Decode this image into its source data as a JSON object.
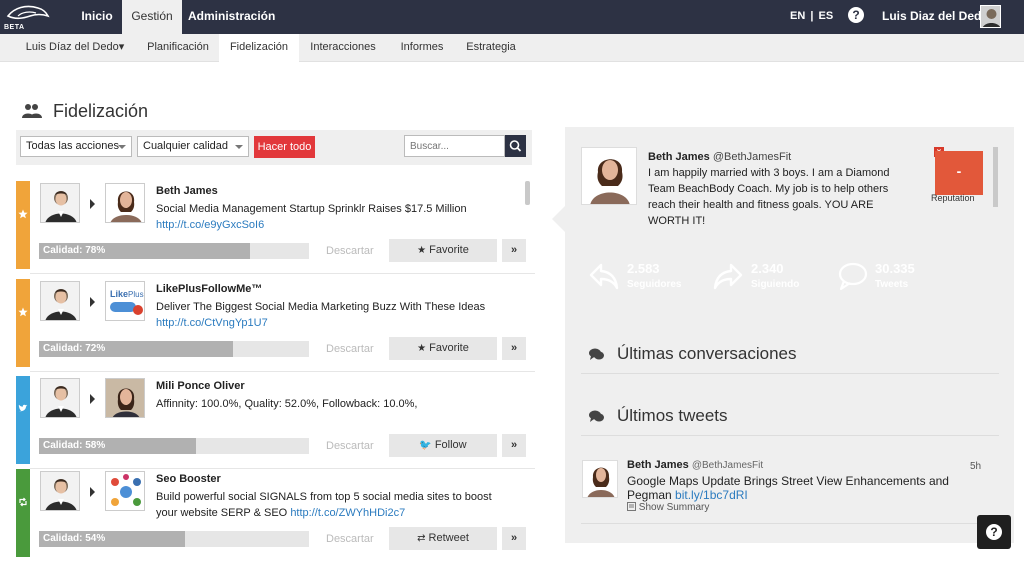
{
  "topnav": {
    "logo_badge": "BETA",
    "items": [
      {
        "label": "Inicio"
      },
      {
        "label": "Gestión"
      },
      {
        "label": "Administración"
      }
    ],
    "lang_en": "EN",
    "lang_sep": "|",
    "lang_es": "ES",
    "help_glyph": "?",
    "user_name": "Luis Diaz del Dedo"
  },
  "subnav": {
    "items": [
      {
        "label": "Luis Díaz del Dedo▾"
      },
      {
        "label": "Planificación"
      },
      {
        "label": "Fidelización"
      },
      {
        "label": "Interacciones"
      },
      {
        "label": "Informes"
      },
      {
        "label": "Estrategia"
      }
    ]
  },
  "page": {
    "title": "Fidelización"
  },
  "filters": {
    "actions_select": "Todas las acciones",
    "quality_select": "Cualquier calidad",
    "do_all_button": "Hacer todo",
    "search_placeholder": "Buscar..."
  },
  "feed": {
    "discard_label": "Descartar",
    "rows": [
      {
        "ribbon_color": "#f0a43a",
        "ribbon_icon": "star-icon",
        "name": "Beth James",
        "text": "Social Media Management Startup Sprinklr Raises $17.5 Million",
        "link": "http://t.co/e9yGxcSoI6",
        "quality_label": "Calidad: 78%",
        "quality": 78,
        "action_icon": "★",
        "action_label": "Favorite"
      },
      {
        "ribbon_color": "#f0a43a",
        "ribbon_icon": "star-icon",
        "name": "LikePlusFollowMe™",
        "text": "Deliver The Biggest Social Media Marketing Buzz With These Ideas",
        "link": "http://t.co/CtVngYp1U7",
        "quality_label": "Calidad: 72%",
        "quality": 72,
        "action_icon": "★",
        "action_label": "Favorite"
      },
      {
        "ribbon_color": "#3ba3db",
        "ribbon_icon": "twitter-bird-icon",
        "name": "Mili Ponce Oliver",
        "text": "Affinnity: 100.0%, Quality: 52.0%, Followback: 10.0%,",
        "link": "",
        "quality_label": "Calidad: 58%",
        "quality": 58,
        "action_icon": "🐦",
        "action_label": "Follow"
      },
      {
        "ribbon_color": "#4a9a3c",
        "ribbon_icon": "retweet-icon",
        "name": "Seo Booster",
        "text": "Build powerful social SIGNALS from top 5 social media sites to boost your website SERP & SEO",
        "link": "http://t.co/ZWYhHDi2c7",
        "quality_label": "Calidad: 54%",
        "quality": 54,
        "action_icon": "⇄",
        "action_label": "Retweet"
      }
    ],
    "more_glyph": "»"
  },
  "profile": {
    "name": "Beth James",
    "handle": "@BethJamesFit",
    "bio": "I am happily married with 3 boys. I am a Diamond Team BeachBody Coach. My job is to help others reach their health and fitness goals. YOU ARE WORTH IT!",
    "reputation_label": "Reputation",
    "reputation_value": "-",
    "close_glyph": "×",
    "stats": [
      {
        "value": "2.583",
        "label": "Seguidores",
        "color": "#3a8fdb"
      },
      {
        "value": "2.340",
        "label": "Siguiendo",
        "color": "#f0a43a"
      },
      {
        "value": "30.335",
        "label": "Tweets",
        "color": "#4a9a3c"
      }
    ]
  },
  "conversations": {
    "title": "Últimas conversaciones"
  },
  "tweets": {
    "title": "Últimos tweets",
    "items": [
      {
        "name": "Beth James",
        "handle": "@BethJamesFit",
        "time": "5h",
        "text": "Google Maps Update Brings Street View Enhancements and Pegman",
        "link": "bit.ly/1bc7dRI",
        "summary": "Show Summary"
      }
    ]
  },
  "help_float": {
    "glyph": "?"
  }
}
